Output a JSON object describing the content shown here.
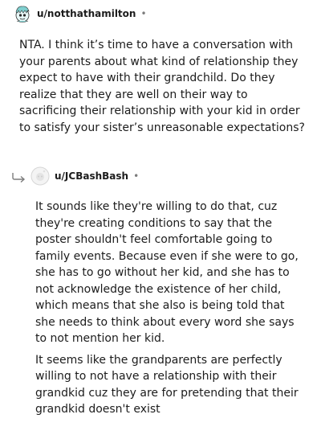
{
  "comments": [
    {
      "username": "u/notthathamilton",
      "separator": "•",
      "avatar_icon": "snoo-avatar-teal-icon",
      "paragraphs": [
        "NTA. I think it’s time to have a conversation with your parents about what kind of relationship they expect to have with their grandchild. Do they realize that they are well on their way to sacrificing their relationship with your kid in order to satisfy your sister’s unreasonable expectations?"
      ]
    },
    {
      "username": "u/JCBashBash",
      "separator": "•",
      "avatar_icon": "default-avatar-icon",
      "reply_icon": "reply-arrow-icon",
      "paragraphs": [
        "It sounds like they're willing to do that, cuz they're creating conditions to say that the poster shouldn't feel comfortable going to family events. Because even if she were to go, she has to go without her kid, and she has to not acknowledge the existence of her child, which means that she also is being told that she needs to think about every word she says to not mention her kid.",
        "It seems like the grandparents are perfectly willing to not have a relationship with their grandkid cuz they are for pretending that their grandkid doesn't exist"
      ]
    }
  ],
  "colors": {
    "text": "#1c1c1c",
    "meta": "#7c7c7c",
    "avatar_teal": "#7fd0d0"
  }
}
